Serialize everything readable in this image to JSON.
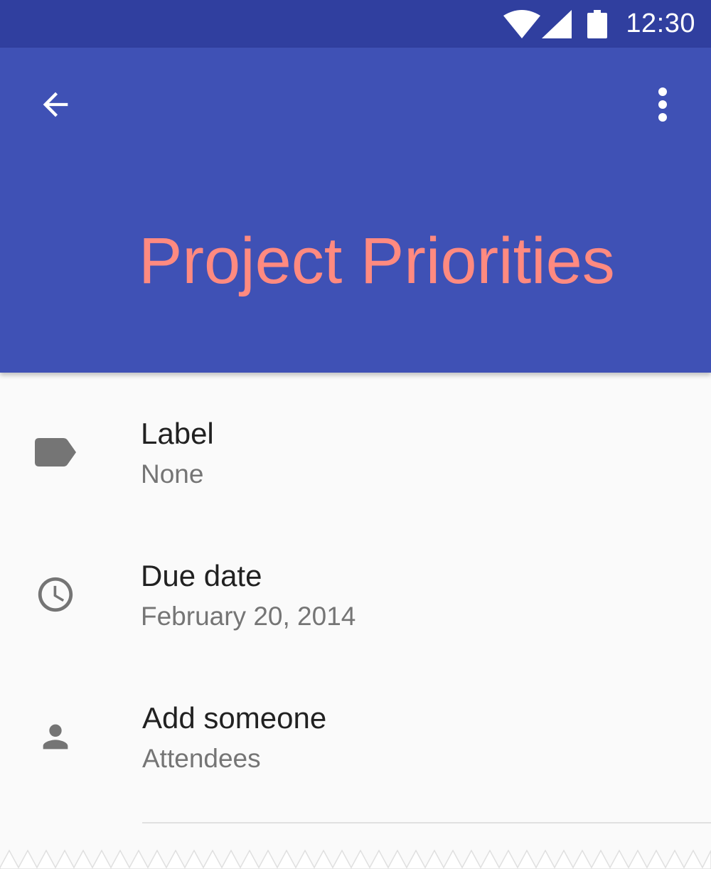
{
  "status_bar": {
    "time": "12:30",
    "icons": [
      "wifi-icon",
      "cell-signal-icon",
      "battery-icon"
    ],
    "background": "#303f9f"
  },
  "app_bar": {
    "title": "Project Priorities",
    "navigation_icon": "arrow-back-icon",
    "overflow_icon": "more-vert-icon",
    "background": "#3f51b5",
    "title_color": "#ff8a80"
  },
  "details": {
    "items": [
      {
        "icon": "label-icon",
        "primary": "Label",
        "secondary": "None"
      },
      {
        "icon": "clock-icon",
        "primary": "Due date",
        "secondary": "February 20, 2014"
      },
      {
        "icon": "person-icon",
        "primary": "Add someone",
        "secondary": "Attendees"
      }
    ],
    "icon_color": "#757575",
    "primary_color": "#212121",
    "secondary_color": "#757575"
  }
}
